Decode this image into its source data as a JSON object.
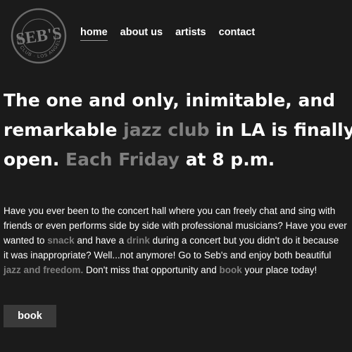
{
  "logo": {
    "name": "SEB'S",
    "ring_text": "JAZZ CLUB · LOS ANGELES"
  },
  "nav": [
    {
      "label": "home",
      "active": true
    },
    {
      "label": "about us",
      "active": false
    },
    {
      "label": "artists",
      "active": false
    },
    {
      "label": "contact",
      "active": false
    }
  ],
  "hero": {
    "p1": "The one and only, inimitable, and",
    "p2": "remarkable ",
    "h1": "jazz club",
    "p3": " in LA is finally",
    "p4": "open. ",
    "h2": "Each Friday",
    "p5": " at 8 p.m."
  },
  "intro": {
    "t1": "Have you ever been to the concert hall where you can freely chat and sing with",
    "t2": "friends or even performs side by side with professional musicians? Have you ever",
    "t3": "wanted to ",
    "h1": "snack",
    "t4": " and have a ",
    "h2": "drink",
    "t5": " during a concert but you didn't do it because",
    "t6": "it was inappropriate? Well...not anymore! Go to Seb's and enjoy both beautiful",
    "h3": "jazz and freedom.",
    "t7": " Don't miss that opportunity and ",
    "h4": "book",
    "t8": " your place today!"
  },
  "cta": {
    "label": "book"
  },
  "colors": {
    "background": "#1b1b1b",
    "text": "#ffffff",
    "muted": "#808080",
    "button": "#3a3a3a"
  }
}
